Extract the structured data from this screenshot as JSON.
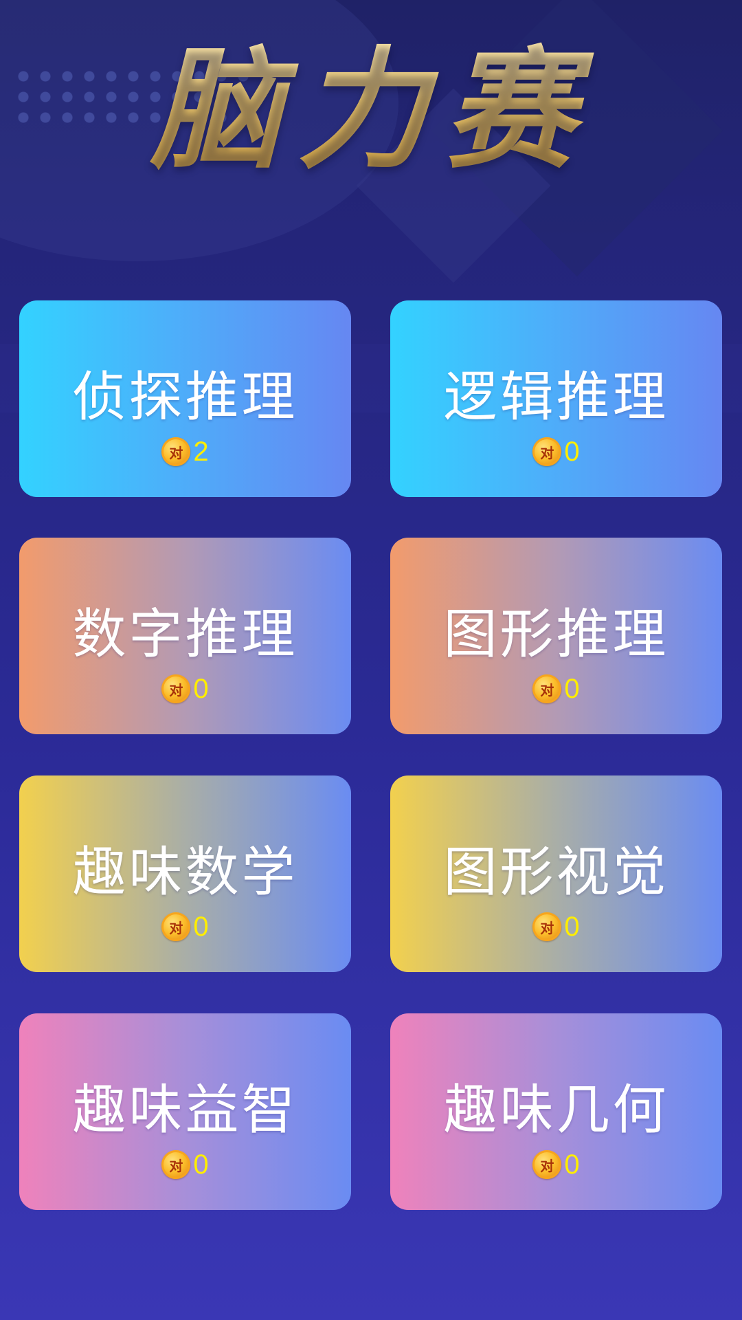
{
  "header": {
    "title": "脑力赛"
  },
  "colors": {
    "background": "#2b2a96",
    "title_gold": "#e8c36a",
    "count_yellow": "#ffee00",
    "card_text": "#ffffff"
  },
  "categories": [
    {
      "name": "侦探推理",
      "coin_label": "对",
      "count": "2",
      "gradient": "blue"
    },
    {
      "name": "逻辑推理",
      "coin_label": "对",
      "count": "0",
      "gradient": "blue"
    },
    {
      "name": "数字推理",
      "coin_label": "对",
      "count": "0",
      "gradient": "orange"
    },
    {
      "name": "图形推理",
      "coin_label": "对",
      "count": "0",
      "gradient": "orange"
    },
    {
      "name": "趣味数学",
      "coin_label": "对",
      "count": "0",
      "gradient": "yellow"
    },
    {
      "name": "图形视觉",
      "coin_label": "对",
      "count": "0",
      "gradient": "yellow"
    },
    {
      "name": "趣味益智",
      "coin_label": "对",
      "count": "0",
      "gradient": "pink"
    },
    {
      "name": "趣味几何",
      "coin_label": "对",
      "count": "0",
      "gradient": "pink"
    }
  ],
  "icons": {
    "coin": "coin-icon"
  }
}
